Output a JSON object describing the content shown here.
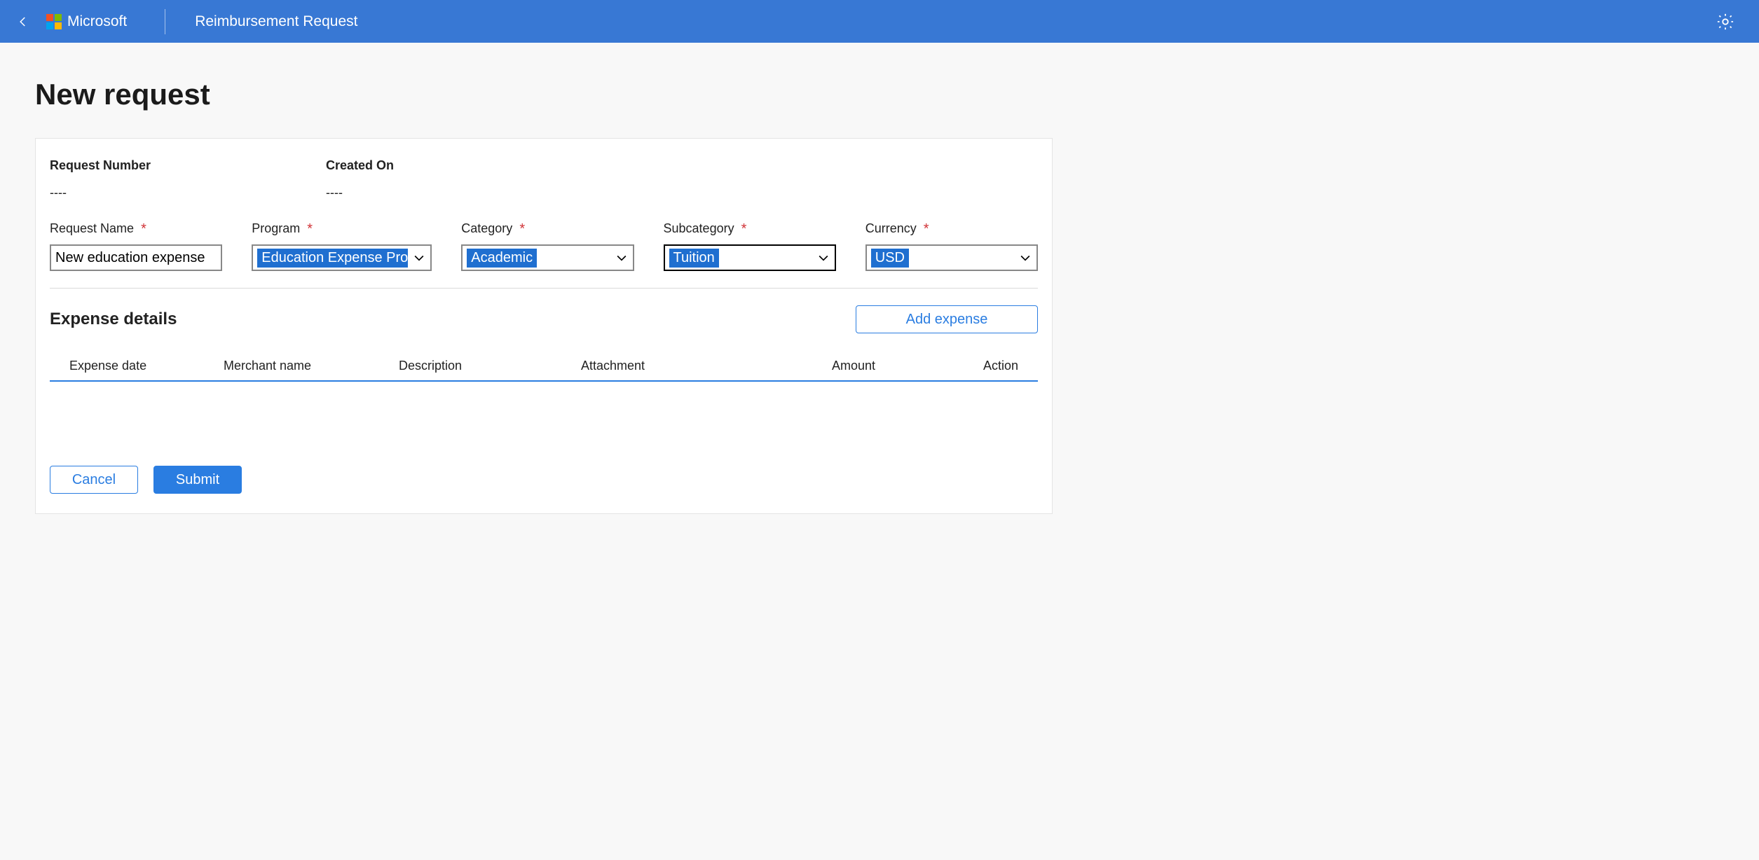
{
  "header": {
    "brand": "Microsoft",
    "appTitle": "Reimbursement Request"
  },
  "page": {
    "title": "New request"
  },
  "readonly": {
    "requestNumberLabel": "Request Number",
    "requestNumberValue": "----",
    "createdOnLabel": "Created On",
    "createdOnValue": "----"
  },
  "form": {
    "requestNameLabel": "Request Name",
    "requestNameValue": "New education expense",
    "programLabel": "Program",
    "programValue": "Education Expense Pro",
    "categoryLabel": "Category",
    "categoryValue": "Academic",
    "subcategoryLabel": "Subcategory",
    "subcategoryValue": "Tuition",
    "currencyLabel": "Currency",
    "currencyValue": "USD"
  },
  "details": {
    "sectionTitle": "Expense details",
    "addExpenseLabel": "Add expense",
    "columns": {
      "date": "Expense date",
      "merchant": "Merchant name",
      "description": "Description",
      "attachment": "Attachment",
      "amount": "Amount",
      "action": "Action"
    }
  },
  "actions": {
    "cancel": "Cancel",
    "submit": "Submit"
  }
}
